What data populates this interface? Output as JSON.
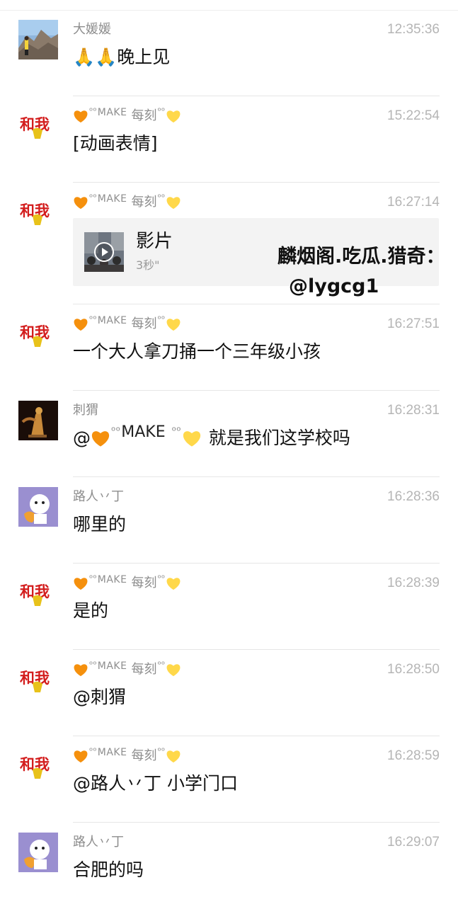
{
  "messages": [
    {
      "sender": "大媛媛",
      "time": "12:35:36",
      "text": "🙏🙏晚上见",
      "avatar": "mountain-photo"
    },
    {
      "sender_label": "MAKE",
      "sender_suffix": "每刻",
      "time": "15:22:54",
      "text": "[动画表情]",
      "avatar": "calligraphy-logo"
    },
    {
      "sender_label": "MAKE",
      "sender_suffix": "每刻",
      "time": "16:27:14",
      "avatar": "calligraphy-logo",
      "video": {
        "title": "影片",
        "duration": "3秒\""
      }
    },
    {
      "sender_label": "MAKE",
      "sender_suffix": "每刻",
      "time": "16:27:51",
      "text": "一个大人拿刀捅一个三年级小孩",
      "avatar": "calligraphy-logo"
    },
    {
      "sender": "刺猬",
      "time": "16:28:31",
      "text_prefix": "@",
      "text_mention": "MAKE",
      "text": "就是我们这学校吗",
      "avatar": "sculpture-photo"
    },
    {
      "sender": "路人丷丁",
      "time": "16:28:36",
      "text": "哪里的",
      "avatar": "cartoon-avatar"
    },
    {
      "sender_label": "MAKE",
      "sender_suffix": "每刻",
      "time": "16:28:39",
      "text": "是的",
      "avatar": "calligraphy-logo"
    },
    {
      "sender_label": "MAKE",
      "sender_suffix": "每刻",
      "time": "16:28:50",
      "text": "@刺猬",
      "avatar": "calligraphy-logo"
    },
    {
      "sender_label": "MAKE",
      "sender_suffix": "每刻",
      "time": "16:28:59",
      "text": "@路人丷丁 小学门口",
      "avatar": "calligraphy-logo"
    },
    {
      "sender": "路人丷丁",
      "time": "16:29:07",
      "text": "合肥的吗",
      "avatar": "cartoon-avatar"
    }
  ],
  "watermark": {
    "line1": "麟烟阁.吃瓜.猎奇：",
    "line2": "@lygcg1"
  },
  "symbols": {
    "tiny_mark": "ᵒᵒ"
  },
  "colors": {
    "heart_orange": "#f5900d",
    "heart_yellow": "#ffd84a",
    "time": "#b5b5b5",
    "name": "#8e8e8e"
  }
}
